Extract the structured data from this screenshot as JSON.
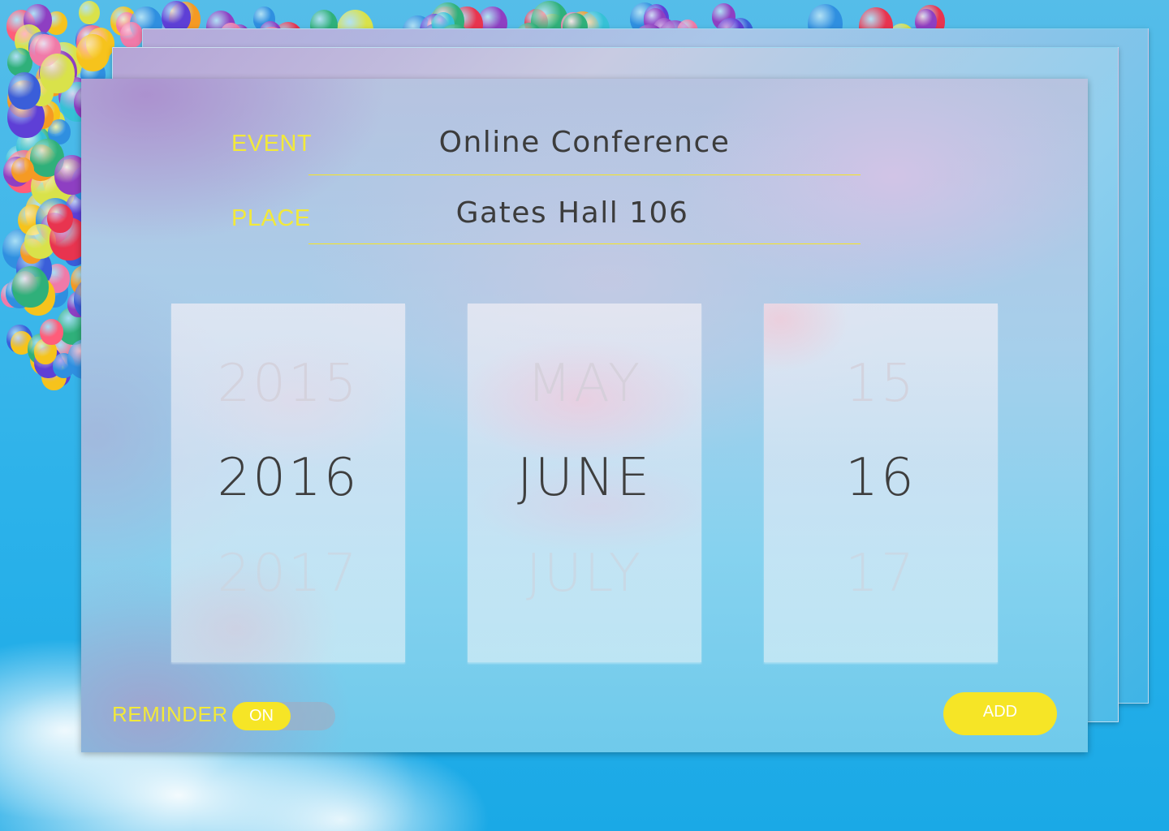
{
  "colors": {
    "accent_yellow": "#f6e526",
    "label_yellow": "#f2e93a",
    "text_dark": "#3c3c3c"
  },
  "form": {
    "event": {
      "label": "EVENT",
      "value": "Online Conference"
    },
    "place": {
      "label": "PLACE",
      "value": "Gates Hall 106"
    }
  },
  "date_picker": {
    "year": {
      "prev": "2015",
      "selected": "2016",
      "next": "2017"
    },
    "month": {
      "prev": "MAY",
      "selected": "JUNE",
      "next": "JULY"
    },
    "day": {
      "prev": "15",
      "selected": "16",
      "next": "17"
    }
  },
  "reminder": {
    "label": "REMINDER",
    "state_label": "ON",
    "enabled": true
  },
  "actions": {
    "add_label": "ADD"
  }
}
